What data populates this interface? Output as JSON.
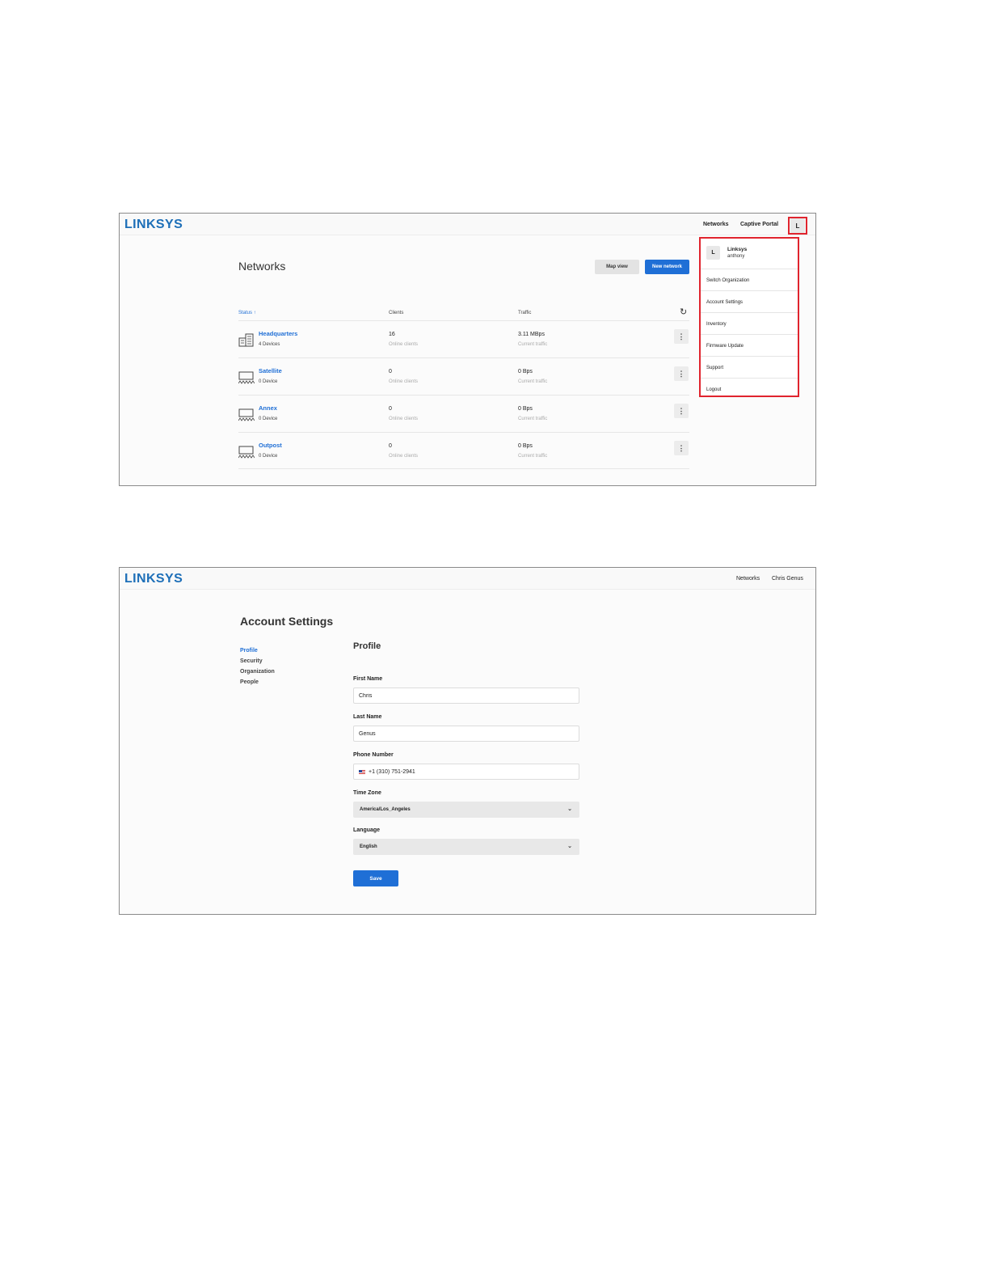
{
  "brand": {
    "logo": "LINKSYS",
    "accent": "#1f6fd6",
    "highlight": "#e0242e"
  },
  "networks_screen": {
    "nav": {
      "networks": "Networks",
      "captive_portal": "Captive Portal",
      "avatar": "L"
    },
    "title": "Networks",
    "map_view": "Map view",
    "new_network": "New network",
    "columns": {
      "status": "Status",
      "clients": "Clients",
      "traffic": "Traffic"
    },
    "rows": [
      {
        "name": "Headquarters",
        "devices": "4 Devices",
        "clients": "16",
        "clients_sub": "Online clients",
        "traffic": "3.11 MBps",
        "traffic_sub": "Current traffic",
        "icon": "building-icon"
      },
      {
        "name": "Satellite",
        "devices": "0 Device",
        "clients": "0",
        "clients_sub": "Online clients",
        "traffic": "0 Bps",
        "traffic_sub": "Current traffic",
        "icon": "shelter-icon"
      },
      {
        "name": "Annex",
        "devices": "0 Device",
        "clients": "0",
        "clients_sub": "Online clients",
        "traffic": "0 Bps",
        "traffic_sub": "Current traffic",
        "icon": "shelter-icon"
      },
      {
        "name": "Outpost",
        "devices": "0 Device",
        "clients": "0",
        "clients_sub": "Online clients",
        "traffic": "0 Bps",
        "traffic_sub": "Current traffic",
        "icon": "shelter-icon"
      }
    ],
    "dropdown": {
      "avatar": "L",
      "user_name": "Linksys",
      "user_org": "anthony",
      "items": [
        "Switch Organization",
        "Account Settings",
        "Inventory",
        "Firmware Update",
        "Support",
        "Logout"
      ]
    }
  },
  "account_screen": {
    "nav": {
      "networks": "Networks",
      "user": "Chris Genus"
    },
    "title": "Account Settings",
    "sidenav": [
      "Profile",
      "Security",
      "Organization",
      "People"
    ],
    "section": "Profile",
    "fields": {
      "first_name_label": "First Name",
      "first_name": "Chris",
      "last_name_label": "Last Name",
      "last_name": "Genus",
      "phone_label": "Phone Number",
      "phone": "+1 (310) 751-2941",
      "timezone_label": "Time Zone",
      "timezone": "America/Los_Angeles",
      "language_label": "Language",
      "language": "English"
    },
    "save": "Save"
  }
}
